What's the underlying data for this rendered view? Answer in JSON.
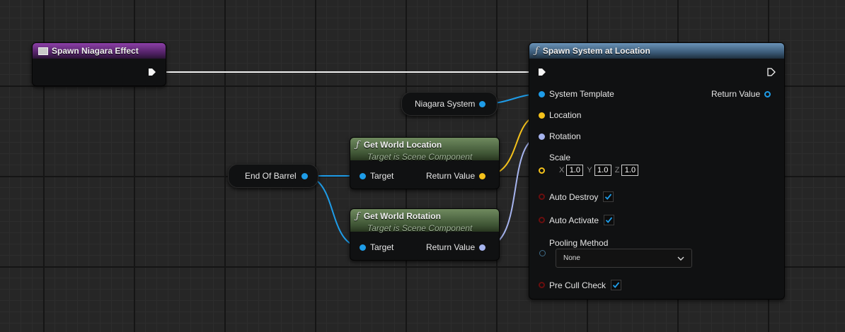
{
  "colors": {
    "exec_wire": "#f0f0f0",
    "object_pin": "#1e9ce8",
    "vector_pin": "#f5c21b",
    "rotator_pin": "#a6b4ee",
    "bool_pin": "#7a0c0c"
  },
  "event_node": {
    "title": "Spawn Niagara Effect",
    "icon": "event-icon"
  },
  "spawn_node": {
    "title": "Spawn System at Location",
    "icon": "function-icon",
    "inputs": {
      "system_template": "System Template",
      "location": "Location",
      "rotation": "Rotation",
      "scale": "Scale",
      "scale_x_label": "X",
      "scale_x": "1.0",
      "scale_y_label": "Y",
      "scale_y": "1.0",
      "scale_z_label": "Z",
      "scale_z": "1.0",
      "auto_destroy": "Auto Destroy",
      "auto_activate": "Auto Activate",
      "pooling_method": "Pooling Method",
      "pooling_value": "None",
      "pre_cull_check": "Pre Cull Check"
    },
    "outputs": {
      "return_value": "Return Value"
    },
    "checked": {
      "auto_destroy": true,
      "auto_activate": true,
      "pre_cull_check": true
    }
  },
  "niagara_var": {
    "label": "Niagara System"
  },
  "barrel_var": {
    "label": "End Of Barrel"
  },
  "get_location_node": {
    "title": "Get World Location",
    "subtitle": "Target is Scene Component",
    "input": "Target",
    "output": "Return Value"
  },
  "get_rotation_node": {
    "title": "Get World Rotation",
    "subtitle": "Target is Scene Component",
    "input": "Target",
    "output": "Return Value"
  }
}
